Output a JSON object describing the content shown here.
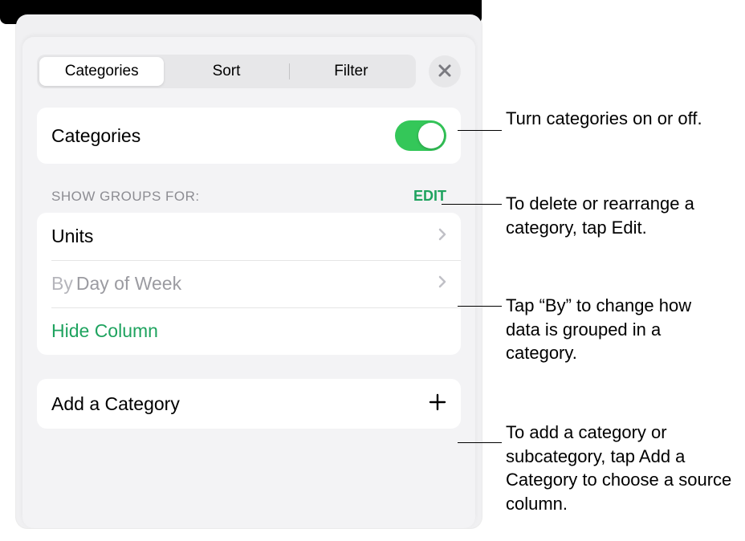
{
  "tabs": {
    "categories": "Categories",
    "sort": "Sort",
    "filter": "Filter"
  },
  "main_toggle": {
    "label": "Categories"
  },
  "groups_section": {
    "header": "Show Groups For:",
    "edit": "EDIT",
    "items": [
      {
        "label": "Units",
        "by": ""
      },
      {
        "label": "Day of Week",
        "by": "By"
      }
    ],
    "hide_column": "Hide Column"
  },
  "add_category": "Add a Category",
  "callouts": {
    "c1": "Turn categories on or off.",
    "c2": "To delete or rearrange a category, tap Edit.",
    "c3": "Tap “By” to change how data is grouped in a category.",
    "c4": "To add a category or subcategory, tap Add a Category to choose a source column."
  }
}
